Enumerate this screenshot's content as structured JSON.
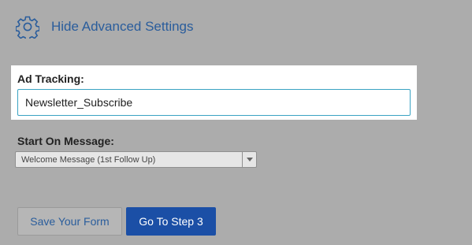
{
  "advanced_toggle": {
    "icon": "gear-icon",
    "label": "Hide Advanced Settings",
    "color": "#2a5d9c"
  },
  "ad_tracking": {
    "label": "Ad Tracking:",
    "value": "Newsletter_Subscribe"
  },
  "start_message": {
    "label": "Start On Message:",
    "selected": "Welcome Message (1st Follow Up)"
  },
  "buttons": {
    "save_label": "Save Your Form",
    "next_label": "Go To Step 3",
    "primary_color": "#1b4fa6"
  }
}
